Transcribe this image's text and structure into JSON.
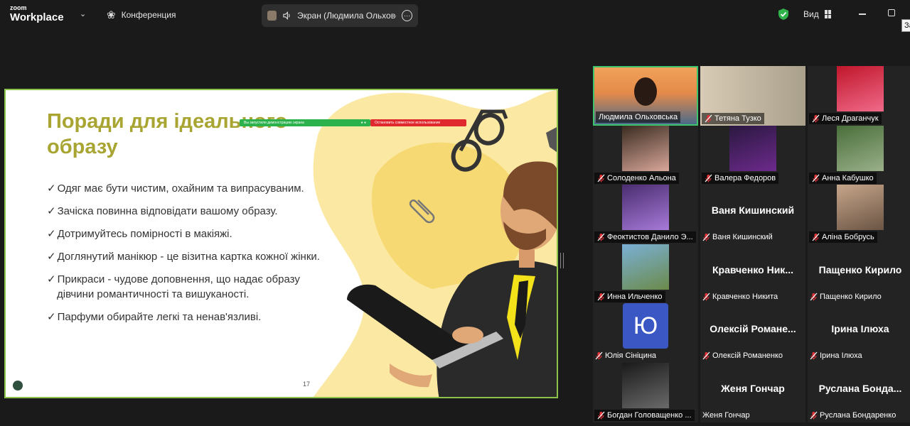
{
  "topbar": {
    "logo_small": "zoom",
    "logo_big": "Workplace",
    "meeting_title": "Конференция",
    "share_label": "Экран (Людмила Ольховська)",
    "view_label": "Вид",
    "tooltip": "За"
  },
  "share_bar": {
    "status_text": "Вы запустили демонстрацию экрана",
    "stop_text": "Остановить совместное использование"
  },
  "slide": {
    "title": "Поради для ідеального образу",
    "bullets": [
      "Одяг має бути чистим, охайним та випрасуваним.",
      "Зачіска повинна відповідати вашому образу.",
      "Дотримуйтесь помірності в макіяжі.",
      "Доглянутий манікюр - це візитна картка кожної жінки.",
      "Прикраси - чудове доповнення, що надає образу дівчини романтичності та вишуканості.",
      "Парфуми обирайте легкі та ненав'язливі."
    ],
    "page_number": "17"
  },
  "participants": [
    {
      "name": "Людмила Ольховська",
      "muted": false,
      "video": true,
      "active": true
    },
    {
      "name": "Тетяна Тузко",
      "muted": true,
      "video": true
    },
    {
      "name": "Леся Драганчук",
      "muted": true,
      "video": true
    },
    {
      "name": "Солоденко Альона",
      "muted": true,
      "video": true
    },
    {
      "name": "Валера Федоров",
      "muted": true,
      "video": true
    },
    {
      "name": "Анна Кабушко",
      "muted": true,
      "video": true
    },
    {
      "name": "Феоктистов Данило Э...",
      "muted": true,
      "video": true
    },
    {
      "name": "Ваня Кишинский",
      "display": "Ваня Кишинский",
      "muted": true,
      "video": false
    },
    {
      "name": "Аліна Бобрусь",
      "muted": true,
      "video": true
    },
    {
      "name": "Инна Ильченко",
      "muted": true,
      "video": true
    },
    {
      "name": "Кравченко Никита",
      "display": "Кравченко Ник...",
      "muted": true,
      "video": false
    },
    {
      "name": "Пащенко Кирило",
      "display": "Пащенко Кирило",
      "muted": true,
      "video": false
    },
    {
      "name": "Юлія Сініцина",
      "muted": true,
      "video": false,
      "initial": "Ю"
    },
    {
      "name": "Олексій Романенко",
      "display": "Олексій Романе...",
      "muted": true,
      "video": false
    },
    {
      "name": "Ірина Ілюха",
      "display": "Ірина Ілюха",
      "muted": true,
      "video": false
    },
    {
      "name": "Богдан Головащенко ...",
      "muted": true,
      "video": true
    },
    {
      "name": "Женя Гончар",
      "display": "Женя Гончар",
      "muted": false,
      "video": false
    },
    {
      "name": "Руслана Бондаренко",
      "display": "Руслана Бонда...",
      "muted": true,
      "video": false
    }
  ],
  "colors": {
    "accent_green": "#3ec46d",
    "mute_red": "#e5353a",
    "slide_title": "#a8a532",
    "slide_border": "#8bc34a"
  }
}
